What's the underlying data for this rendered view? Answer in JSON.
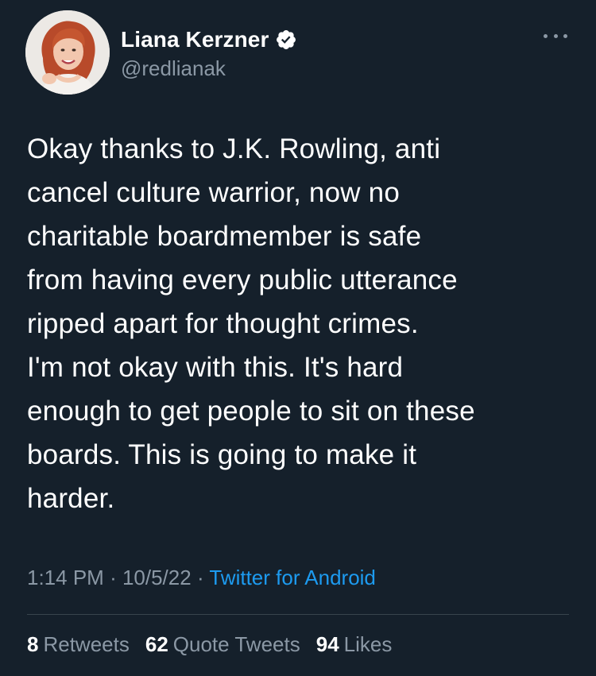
{
  "author": {
    "display_name": "Liana Kerzner",
    "handle": "@redlianak",
    "verified": true,
    "verified_icon": "verified-badge-icon"
  },
  "tweet": {
    "text": "Okay thanks to J.K. Rowling, anti\ncancel culture warrior, now no\ncharitable boardmember is safe\nfrom having every public utterance\nripped apart for thought crimes.\nI'm not okay with this. It's hard\nenough to get people to sit on these\nboards. This is going to make it\nharder.",
    "time": "1:14 PM",
    "separator": "·",
    "date": "10/5/22",
    "source": "Twitter for Android"
  },
  "stats": {
    "retweets_count": "8",
    "retweets_label": "Retweets",
    "quotes_count": "62",
    "quotes_label": "Quote Tweets",
    "likes_count": "94",
    "likes_label": "Likes"
  },
  "colors": {
    "background": "#15202b",
    "text_primary": "#ffffff",
    "text_secondary": "#8b98a5",
    "accent": "#1d9bf0",
    "divider": "#38444d"
  }
}
